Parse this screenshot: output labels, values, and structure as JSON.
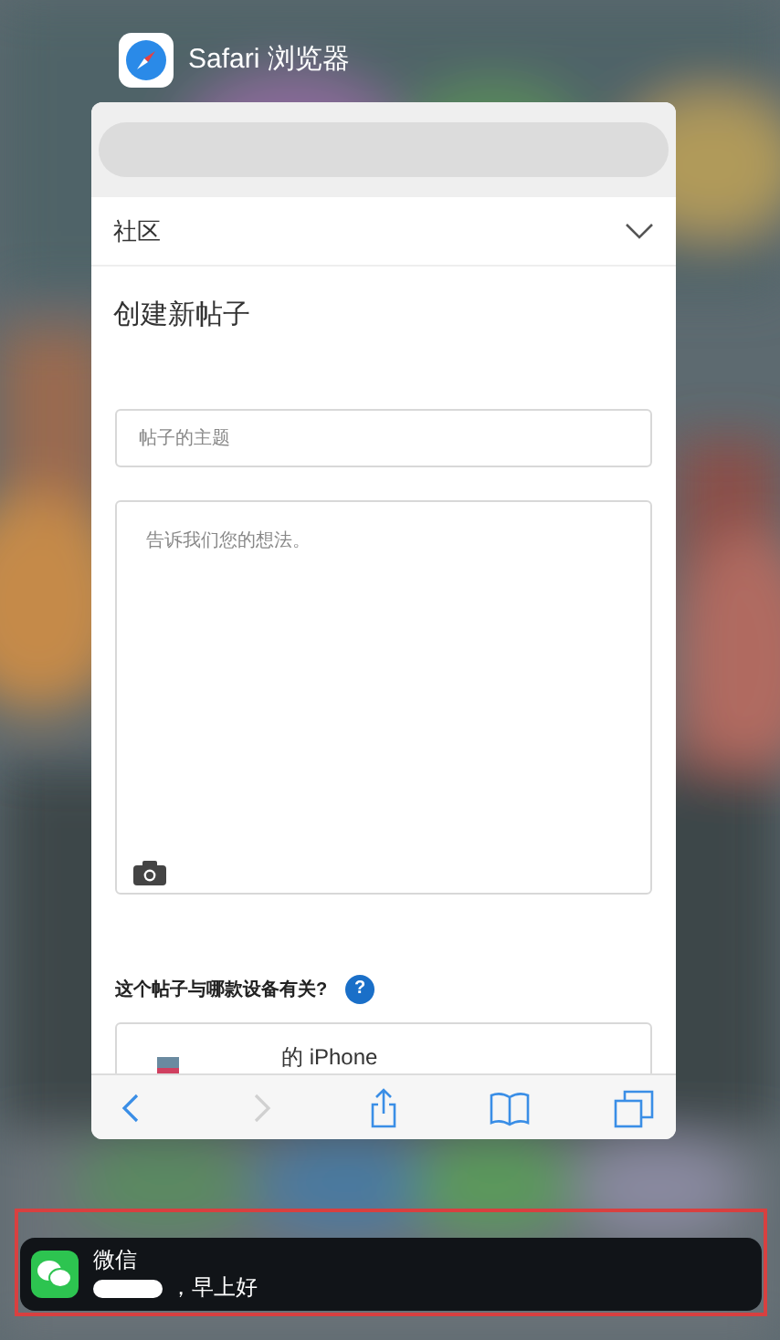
{
  "app_header": {
    "title": "Safari 浏览器"
  },
  "page": {
    "section_menu": {
      "label": "社区",
      "expanded": false
    },
    "heading": "创建新帖子",
    "subject_field": {
      "placeholder": "帖子的主题"
    },
    "body_field": {
      "placeholder": "告诉我们您的想法。"
    },
    "device_question": "这个帖子与哪款设备有关?",
    "help_button": {
      "label": "?"
    },
    "device_option": {
      "label": "的 iPhone"
    }
  },
  "toolbar": [
    {
      "kind": "back",
      "disabled": false
    },
    {
      "kind": "forward",
      "disabled": true
    },
    {
      "kind": "share",
      "disabled": false
    },
    {
      "kind": "bookmarks",
      "disabled": false
    },
    {
      "kind": "tabs",
      "disabled": false
    }
  ],
  "notification": {
    "app": "微信",
    "message": "，早上好"
  }
}
